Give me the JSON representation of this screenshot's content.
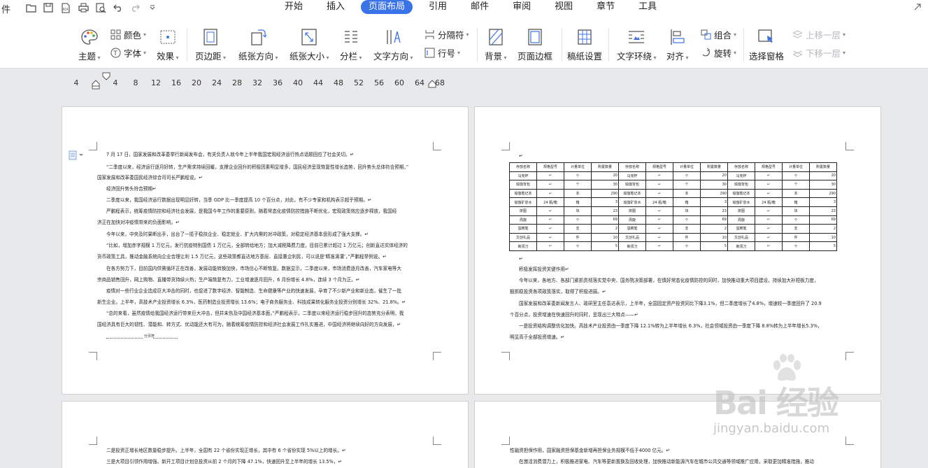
{
  "menubar": {
    "file_char": "件",
    "tabs": [
      "开始",
      "插入",
      "页面布局",
      "引用",
      "邮件",
      "审阅",
      "视图",
      "章节",
      "工具"
    ],
    "active_tab": "页面布局"
  },
  "ribbon": {
    "theme": "主题",
    "color": "颜色",
    "font": "字体",
    "effect": "效果",
    "margin": "页边距",
    "orientation": "纸张方向",
    "size": "纸张大小",
    "columns": "分栏",
    "text_direction": "文字方向",
    "separator": "分隔符",
    "line_number": "行号",
    "background": "背景",
    "page_border": "页面边框",
    "manuscript": "稿纸设置",
    "wrap_text": "文字环绕",
    "align": "对齐",
    "group": "组合",
    "rotate": "旋转",
    "selection_pane": "选择窗格",
    "bring_forward": "上移一层",
    "send_backward": "下移一层"
  },
  "ruler": {
    "ticks": [
      "4",
      "4",
      "8",
      "12",
      "16",
      "20",
      "24",
      "28",
      "32",
      "36",
      "40",
      "44",
      "48",
      "52",
      "56",
      "60",
      "64",
      "68"
    ]
  },
  "page1": {
    "paras": [
      "7 月 17 日，国家发展和改革委举行新闻发布会，有关负责人就今年上半年我国宏观经济运行热点话题回应了社会关切。↵",
      "“二季度以来，经济运行逐月好转，生产需求持续回暖，支撑企业回升的积极因素明显增多，国民经济呈现恢复性增长态势，回升势头总体符合预期，”",
      "国家发展和改革委国民经济综合司司长严鹏程说。↵",
      "经济回升势头符合预期↵",
      "二季度以来，我国经济运行数据出现明显好转，当季 GDP 比一季度提高 10 个百分点，对此，有不少专家和机构表示超乎预期。↵",
      "严鹏程表示，统筹疫情防控和经济社会发展，是我国今年工作的重要原则，随着常态化疫情防控措施不断优化，宏观政策效应逐步释放，我国经",
      "济正在加快对冲疫情带来的负面影响。↵",
      "今年以来，中央及时果断出手，出台了一揽子稳扶企业、稳定就业、扩大内需的对冲政策，对稳定经济基本盘形成了强大支撑。↵",
      "“比如，增加赤字规模 1 万亿元，发行抗疫特别国债 1 万亿元，全部转给地方；加大减税降费力度，目前已累计超过 1 万亿元；创新直达实体经济的",
      "货币政策工具，推动金融系统向企业合理让利 1.5 万亿元，这些政策都直达地方基层、直接惠企利民，可以说是‘精准滴灌’，”严鹏程举例说。↵",
      "在各方努力下，目前国内供需循环正在改善，发展动能转换加快，市场信心不断恢复。数据显示，二季度以来，市场消费逐月改善，汽车家电等大",
      "宗商品销售回升，网上购物、直播带货持续火热；生产端恢复有力，工业增速逐月回升，6 月份增长 4.8%，连续 3 个月为正。↵",
      "疫情对一些行业企业造成巨大冲击的同时，也促进了数字经济、智能制造、生命健康等产业的快速发展，孕育了不少新产业和新业态，催生了一批",
      "新生企业。上半年，高技术产业投资增长 6.3%，医药制造业投资增长 13.6%；电子商务服务业、科技成果转化服务业投资分别增长 32%、21.8%。↵",
      "“总的来看，虽然疫情给我国经济运行带来巨大冲击，但并未伤及中国经济基本面，”严鹏程表示，二季度以来经济运行稳步回升的态势充分表明，我",
      "国经济具有巨大的韧性、潜能和、转方式、优动能还大有可为，随着统筹疫情防控和经济社会发展工作扎实推进，中国经济将继续向好的方向发展，↵"
    ],
    "section_break": "分页符"
  },
  "page2": {
    "table_rows": [
      [
        "存放名称",
        "规格型号",
        "计量单位",
        "购置数量",
        "存放名称",
        "规格型号",
        "计量单位",
        "购置数量",
        "存放名称",
        "规格型号",
        "计量单位",
        "购置数量"
      ],
      [
        "马克杯",
        "↵",
        "个",
        "20",
        "马克杯",
        "↵",
        "个",
        "20",
        "马克杯",
        "↵",
        "个",
        "20"
      ],
      [
        "瑜伽背包",
        "↵",
        "个",
        "30",
        "瑜伽背包",
        "↵",
        "个",
        "30",
        "瑜伽背包",
        "↵",
        "个",
        "30"
      ],
      [
        "瑜伽笔记本",
        "↵",
        "本",
        "290",
        "瑜伽笔记本",
        "↵",
        "本",
        "290",
        "瑜伽笔记本",
        "↵",
        "本",
        "290"
      ],
      [
        "瑜伽矿泉水",
        "24 瓶/箱",
        "箱",
        "3",
        "瑜伽矿泉水",
        "24 瓶/箱",
        "箱",
        "3",
        "瑜伽矿泉水",
        "24 瓶/箱",
        "箱",
        "3"
      ],
      [
        "拼图",
        "↵",
        "块",
        "23",
        "拼图",
        "↵",
        "块",
        "23",
        "拼图",
        "↵",
        "块",
        "23"
      ],
      [
        "周旋",
        "↵",
        "个",
        "69",
        "周旋",
        "↵",
        "个",
        "69",
        "周旋",
        "↵",
        "个",
        "69"
      ],
      [
        "蛋糕笔",
        "↵",
        "支",
        "2",
        "蛋糕笔",
        "↵",
        "支",
        "2",
        "蛋糕笔",
        "↵",
        "支",
        "2"
      ],
      [
        "文创礼品",
        "↵",
        "件",
        "10",
        "文创礼品",
        "↵",
        "件",
        "10",
        "文创礼品",
        "↵",
        "件",
        "10"
      ],
      [
        "剃须刀",
        "↵",
        "个",
        "5",
        "剃须刀",
        "↵",
        "个",
        "5",
        "剃须刀",
        "↵",
        "个",
        "5"
      ]
    ],
    "paras": [
      "积极发挥投资关键作用↵",
      "今年以来，各地方、各部门紧抓贯彻落实党中央、国务院决策部署，在慎好常态化疫情防控的同时，加快推动重大项目建设，持续加大补短板力度，",
      "狠抓稳投资各项政策落实，取得了积极进展。↵",
      "国家发展和改革委新闻发言人、政研室主任袁达表示，上半年，全国固定资产投资同比下降3.1%，但二季度增长了4.8%，增速较一季度回升了 20.9",
      "个百分点，投资增速在快速回升的同时，呈现出三大特点——↵",
      "一是投资结构调整优化加快。高技术产业投资由一季度下降 12.1%转为上半年增长 6.3%，社会领域投资由一季度下降 8.8%转为上半年增长5.3%，",
      "明显高于全部投资增速。↵"
    ]
  },
  "page3": {
    "paras": [
      "二是投资正增长地区数量稳步提升。上半年，全国有 22 个省份实现正增长，其中有 6 个省份实现 5%以上的增长。↵",
      "三是大项目引领作用增强。新开工项目计划总投资从前 2 个月的下降 47.1%，快速回升至上半年的增长 13.5%，↵"
    ]
  },
  "page4": {
    "paras": [
      "性融资担保作用，国家融资担保基金新增再担保业务规模不低于4000 亿元。↵",
      "在激活消费潜力上，积极推进家电、汽车等更新置换及回收处理，加快推动新能源汽车在城市公共交通等领域推广应用，采取更加精准措施，推动"
    ]
  },
  "watermark": {
    "logo": "Bai 经验",
    "url": "jingyan.baidu.com"
  }
}
